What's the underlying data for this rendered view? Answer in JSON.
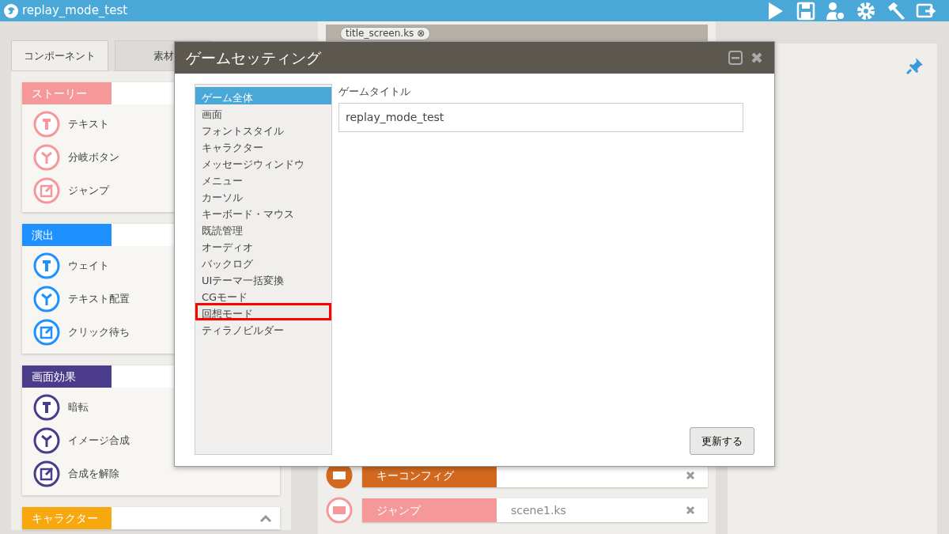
{
  "app": {
    "title": "replay_mode_test"
  },
  "left_tabs": [
    {
      "label": "コンポーネント",
      "selected": true
    },
    {
      "label": "素材",
      "selected": false
    }
  ],
  "sections": [
    {
      "title": "ストーリー",
      "color": "#f4989a",
      "items": [
        {
          "label": "テキスト"
        },
        {
          "label": "分岐ボタン"
        },
        {
          "label": "ジャンプ"
        }
      ]
    },
    {
      "title": "演出",
      "color": "#1e90ff",
      "items": [
        {
          "label": "ウェイト"
        },
        {
          "label": "テキスト配置"
        },
        {
          "label": "クリック待ち"
        }
      ]
    },
    {
      "title": "画面効果",
      "color": "#4b3b8b",
      "items": [
        {
          "label": "暗転"
        },
        {
          "label": "イメージ合成"
        },
        {
          "label": "合成を解除"
        }
      ]
    },
    {
      "title": "キャラクター",
      "color": "#f7a80f"
    }
  ],
  "script_tab": {
    "label": "title_screen.ks ⊗"
  },
  "timeline": [
    {
      "label": "キーコンフィグ",
      "color": "#d2691e"
    },
    {
      "label": "ジャンプ",
      "value": "scene1.ks",
      "color": "#f4989a"
    }
  ],
  "dialog": {
    "title": "ゲームセッティング",
    "menu": [
      {
        "label": "ゲーム全体",
        "selected": true,
        "highlighted": false
      },
      {
        "label": "画面",
        "selected": false,
        "highlighted": false
      },
      {
        "label": "フォントスタイル",
        "selected": false,
        "highlighted": false
      },
      {
        "label": "キャラクター",
        "selected": false,
        "highlighted": false
      },
      {
        "label": "メッセージウィンドウ",
        "selected": false,
        "highlighted": false
      },
      {
        "label": "メニュー",
        "selected": false,
        "highlighted": false
      },
      {
        "label": "カーソル",
        "selected": false,
        "highlighted": false
      },
      {
        "label": "キーボード・マウス",
        "selected": false,
        "highlighted": false
      },
      {
        "label": "既読管理",
        "selected": false,
        "highlighted": false
      },
      {
        "label": "オーディオ",
        "selected": false,
        "highlighted": false
      },
      {
        "label": "バックログ",
        "selected": false,
        "highlighted": false
      },
      {
        "label": "UIテーマ一括変換",
        "selected": false,
        "highlighted": false
      },
      {
        "label": "CGモード",
        "selected": false,
        "highlighted": false
      },
      {
        "label": "回想モード",
        "selected": false,
        "highlighted": true
      },
      {
        "label": "ティラノビルダー",
        "selected": false,
        "highlighted": false
      }
    ],
    "field_label": "ゲームタイトル",
    "field_value": "replay_mode_test",
    "button": "更新する"
  }
}
